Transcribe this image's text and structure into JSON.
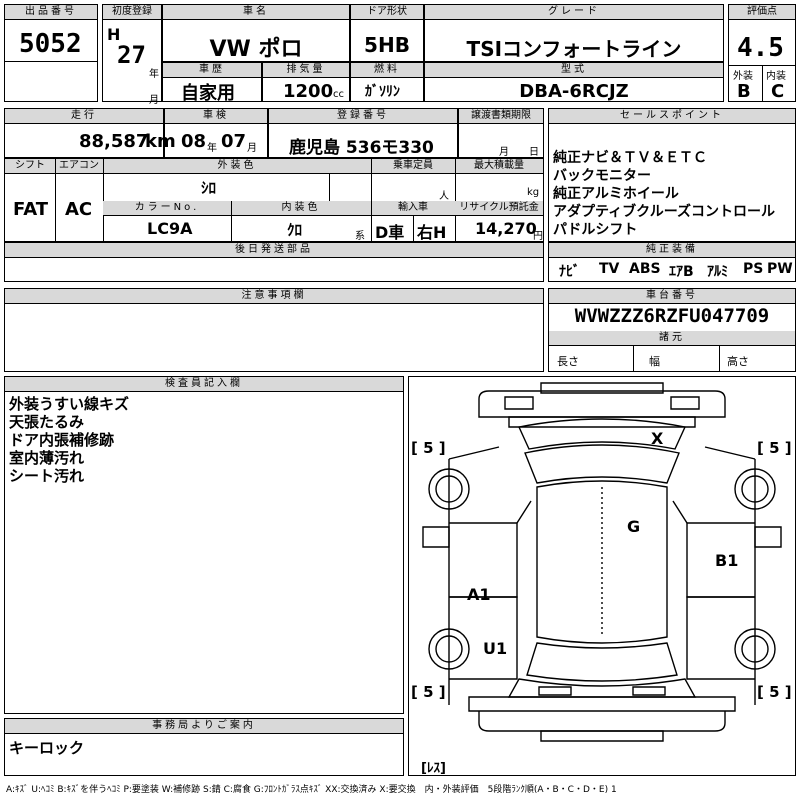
{
  "lot": {
    "label": "出品番号",
    "value": "5052"
  },
  "first_reg": {
    "label": "初度登録",
    "era": "H",
    "year": "27",
    "year_unit": "年",
    "month_unit": "月"
  },
  "car_name": {
    "label": "車名",
    "value": "VW ポロ"
  },
  "door": {
    "label": "ドア形状",
    "value": "5HB"
  },
  "grade": {
    "label": "グレード",
    "value": "TSIコンフォートライン"
  },
  "score": {
    "label": "評価点",
    "value": "4.5",
    "ext_label": "外装",
    "int_label": "内装",
    "ext": "B",
    "int": "C"
  },
  "history": {
    "label": "車歴",
    "value": "自家用"
  },
  "displacement": {
    "label": "排気量",
    "value": "1200",
    "unit": "cc"
  },
  "fuel": {
    "label": "燃料",
    "value": "ｶﾞｿﾘﾝ"
  },
  "model": {
    "label": "型式",
    "value": "DBA-6RCJZ"
  },
  "mileage": {
    "label": "走行",
    "value": "88,587",
    "unit": "km"
  },
  "inspection": {
    "label": "車検",
    "year": "08",
    "year_unit": "年",
    "month": "07",
    "month_unit": "月"
  },
  "registration": {
    "label": "登録番号",
    "value": "鹿児島 536モ330"
  },
  "transfer": {
    "label": "譲渡書類期限",
    "month_unit": "月",
    "day_unit": "日"
  },
  "sales_point": {
    "label": "セールスポイント",
    "lines": [
      "純正ナビ＆ＴＶ＆ＥＴＣ",
      "バックモニター",
      "純正アルミホイール",
      "アダプティブクルーズコントロール",
      "パドルシフト"
    ]
  },
  "shift": {
    "label": "シフト",
    "value": "FAT"
  },
  "ac": {
    "label": "エアコン",
    "value": "AC"
  },
  "ext_color": {
    "label": "外装色",
    "value": "ｼﾛ"
  },
  "capacity": {
    "label": "乗車定員",
    "unit": "人"
  },
  "load": {
    "label": "最大積載量",
    "unit": "kg"
  },
  "color_no": {
    "label": "カラーNo.",
    "value": "LC9A"
  },
  "int_color": {
    "label": "内装色",
    "value": "ｸﾛ",
    "unit": "系"
  },
  "import": {
    "label": "輸入車",
    "value": "D車",
    "handle": "右H"
  },
  "recycle": {
    "label": "リサイクル預託金",
    "value": "14,270",
    "unit": "円"
  },
  "later_parts": {
    "label": "後日発送部品"
  },
  "equipment": {
    "label": "純正装備",
    "items": [
      "ﾅﾋﾞ",
      "TV",
      "ABS",
      "ｴｱB",
      "ｱﾙﾐ",
      "PS",
      "PW"
    ]
  },
  "notes": {
    "label": "注意事項欄"
  },
  "chassis": {
    "label": "車台番号",
    "value": "WVWZZZ6RZFU047709",
    "specs_label": "諸元",
    "length": "長さ",
    "width": "幅",
    "height": "高さ"
  },
  "inspector": {
    "label": "検査員記入欄",
    "lines": [
      "外装うすい線キズ",
      "天張たるみ",
      "ドア内張補修跡",
      "室内薄汚れ",
      "シート汚れ"
    ]
  },
  "office": {
    "label": "事務局よりご案内",
    "value": "キーロック"
  },
  "diagram": {
    "tire_fl": "[ 5 ]",
    "tire_fr": "[ 5 ]",
    "tire_rl": "[ 5 ]",
    "tire_rr": "[ 5 ]",
    "spare": "[ﾚｽ]",
    "marks": {
      "windshield": "X",
      "roof": "G",
      "rear_door_r": "B1",
      "rear_door_l": "A1",
      "rear_fender_l": "U1"
    }
  },
  "legend": "A:ｷｽﾞ U:ﾍｺﾐ B:ｷｽﾞを伴うﾍｺﾐ P:要塗装 W:補修跡 S:錆 C:腐食 G:ﾌﾛﾝﾄｶﾞﾗｽ点ｷｽﾞ XX:交換済み X:要交換　内・外装評価　5段階ﾗﾝｸ順(A・B・C・D・E) 1"
}
